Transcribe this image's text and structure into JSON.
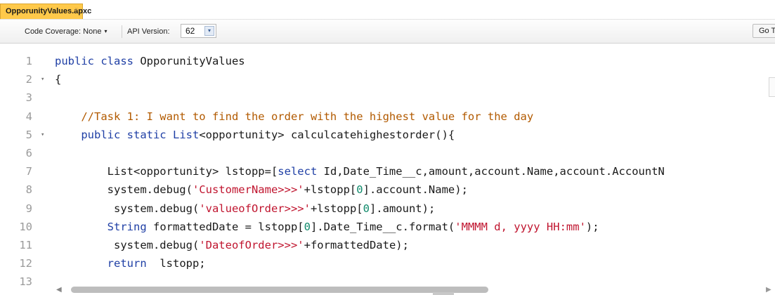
{
  "tab": {
    "title": "OpporunityValues.apxc",
    "close_symbol": "×"
  },
  "toolbar": {
    "coverage_label": "Code Coverage: None",
    "coverage_arrow": "▾",
    "api_label": "API Version:",
    "api_value": "62",
    "api_arrow": "▾",
    "goto_label": "Go T"
  },
  "editor": {
    "lines": [
      {
        "n": "1",
        "fold": "",
        "tokens": [
          [
            "kw",
            "public class "
          ],
          [
            "",
            "OpporunityValues"
          ]
        ]
      },
      {
        "n": "2",
        "fold": "▾",
        "tokens": [
          [
            "",
            "{"
          ]
        ]
      },
      {
        "n": "3",
        "fold": "",
        "tokens": []
      },
      {
        "n": "4",
        "fold": "",
        "tokens": [
          [
            "cm",
            "    //Task 1: I want to find the order with the highest value for the day"
          ]
        ]
      },
      {
        "n": "5",
        "fold": "▾",
        "tokens": [
          [
            "kw",
            "    public static "
          ],
          [
            "kw",
            "List"
          ],
          [
            "",
            "<opportunity> calculcatehighestorder(){"
          ]
        ]
      },
      {
        "n": "6",
        "fold": "",
        "tokens": []
      },
      {
        "n": "7",
        "fold": "",
        "tokens": [
          [
            "",
            "        List<opportunity> lstopp=["
          ],
          [
            "kw",
            "select"
          ],
          [
            "",
            " Id,Date_Time__c,amount,account.Name,account.AccountN"
          ]
        ]
      },
      {
        "n": "8",
        "fold": "",
        "tokens": [
          [
            "",
            "        system.debug("
          ],
          [
            "str",
            "'CustomerName>>>'"
          ],
          [
            "",
            "+lstopp["
          ],
          [
            "num",
            "0"
          ],
          [
            "",
            "].account.Name);"
          ]
        ]
      },
      {
        "n": "9",
        "fold": "",
        "tokens": [
          [
            "",
            "         system.debug("
          ],
          [
            "str",
            "'valueofOrder>>>'"
          ],
          [
            "",
            "+lstopp["
          ],
          [
            "num",
            "0"
          ],
          [
            "",
            "].amount);"
          ]
        ]
      },
      {
        "n": "10",
        "fold": "",
        "tokens": [
          [
            "kw",
            "        String"
          ],
          [
            "",
            " formattedDate = lstopp["
          ],
          [
            "num",
            "0"
          ],
          [
            "",
            "].Date_Time__c.format("
          ],
          [
            "str",
            "'MMMM d, yyyy HH:mm'"
          ],
          [
            "",
            ");"
          ]
        ]
      },
      {
        "n": "11",
        "fold": "",
        "tokens": [
          [
            "",
            "         system.debug("
          ],
          [
            "str",
            "'DateofOrder>>>'"
          ],
          [
            "",
            "+formattedDate);"
          ]
        ]
      },
      {
        "n": "12",
        "fold": "",
        "tokens": [
          [
            "kw",
            "        return"
          ],
          [
            "",
            "  lstopp;"
          ]
        ]
      },
      {
        "n": "13",
        "fold": "",
        "tokens": []
      }
    ]
  },
  "scrollbar": {
    "left_arrow": "◀",
    "right_arrow": "▶"
  }
}
